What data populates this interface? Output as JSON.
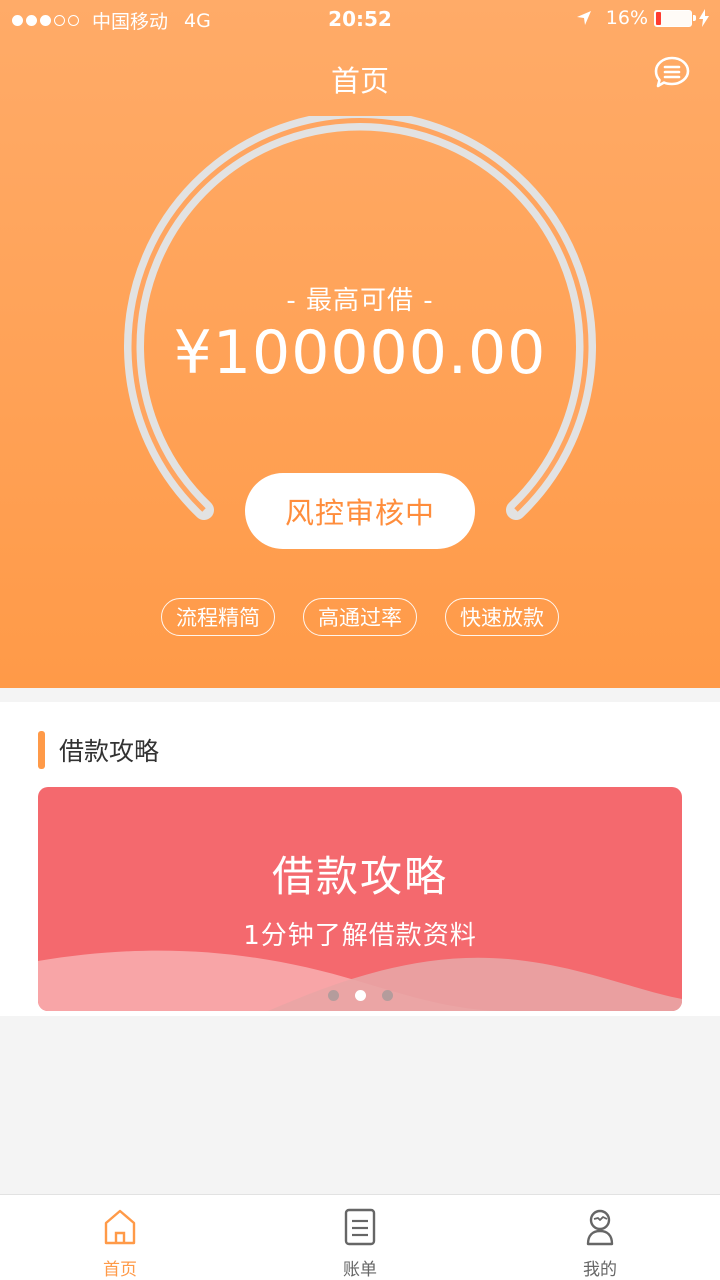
{
  "status_bar": {
    "carrier": "中国移动",
    "network": "4G",
    "time": "20:52",
    "battery": "16%",
    "battery_level": 0.16
  },
  "header": {
    "title": "首页"
  },
  "gauge": {
    "label": "- 最高可借 -",
    "amount": "¥100000.00",
    "status_button": "风控审核中"
  },
  "tags": [
    "流程精简",
    "高通过率",
    "快速放款"
  ],
  "guide": {
    "section_title": "借款攻略",
    "banner_title": "借款攻略",
    "banner_subtitle": "1分钟了解借款资料",
    "pager_count": 3,
    "pager_active": 1
  },
  "tabbar": {
    "items": [
      {
        "label": "首页",
        "icon": "home-icon",
        "active": true
      },
      {
        "label": "账单",
        "icon": "bill-icon",
        "active": false
      },
      {
        "label": "我的",
        "icon": "profile-icon",
        "active": false
      }
    ]
  },
  "colors": {
    "primary": "#ff9a48",
    "banner": "#f4696e",
    "gauge_ring": "#e2e2e2"
  }
}
